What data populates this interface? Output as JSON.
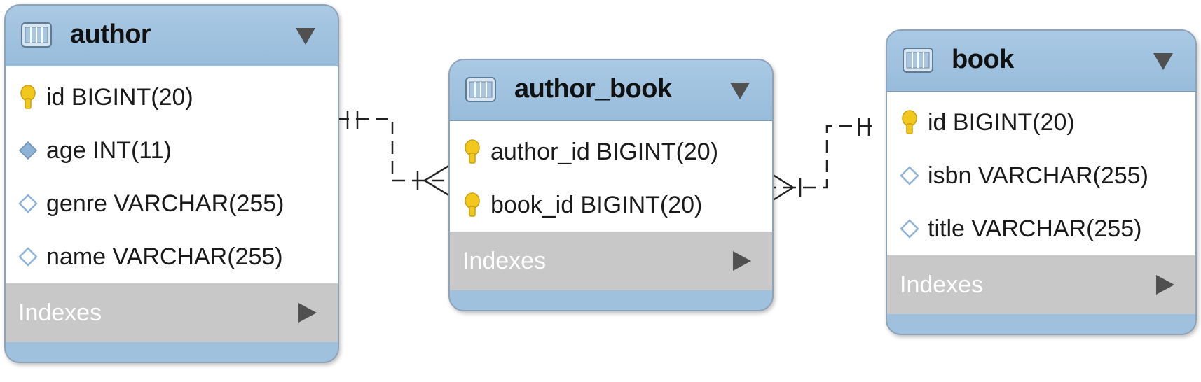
{
  "tables": {
    "author": {
      "name": "author",
      "columns": [
        {
          "text": "id BIGINT(20)",
          "icon": "primary-key-icon"
        },
        {
          "text": "age INT(11)",
          "icon": "column-filled-diamond-icon"
        },
        {
          "text": "genre VARCHAR(255)",
          "icon": "column-diamond-icon"
        },
        {
          "text": "name VARCHAR(255)",
          "icon": "column-diamond-icon"
        }
      ],
      "indexes_label": "Indexes"
    },
    "author_book": {
      "name": "author_book",
      "columns": [
        {
          "text": "author_id BIGINT(20)",
          "icon": "primary-key-icon"
        },
        {
          "text": "book_id BIGINT(20)",
          "icon": "primary-key-icon"
        }
      ],
      "indexes_label": "Indexes"
    },
    "book": {
      "name": "book",
      "columns": [
        {
          "text": "id BIGINT(20)",
          "icon": "primary-key-icon"
        },
        {
          "text": "isbn VARCHAR(255)",
          "icon": "column-diamond-icon"
        },
        {
          "text": "title VARCHAR(255)",
          "icon": "column-diamond-icon"
        }
      ],
      "indexes_label": "Indexes"
    }
  },
  "relationships": [
    {
      "from": "author",
      "to": "author_book",
      "from_cardinality": "one-and-only-one",
      "to_cardinality": "one-or-many"
    },
    {
      "from": "book",
      "to": "author_book",
      "from_cardinality": "one-and-only-one",
      "to_cardinality": "one-or-many"
    }
  ],
  "colors": {
    "header": "#9fc1de",
    "indexes": "#c8c8c8",
    "key": "#f2c81e",
    "diamond": "#8fb3d6"
  }
}
